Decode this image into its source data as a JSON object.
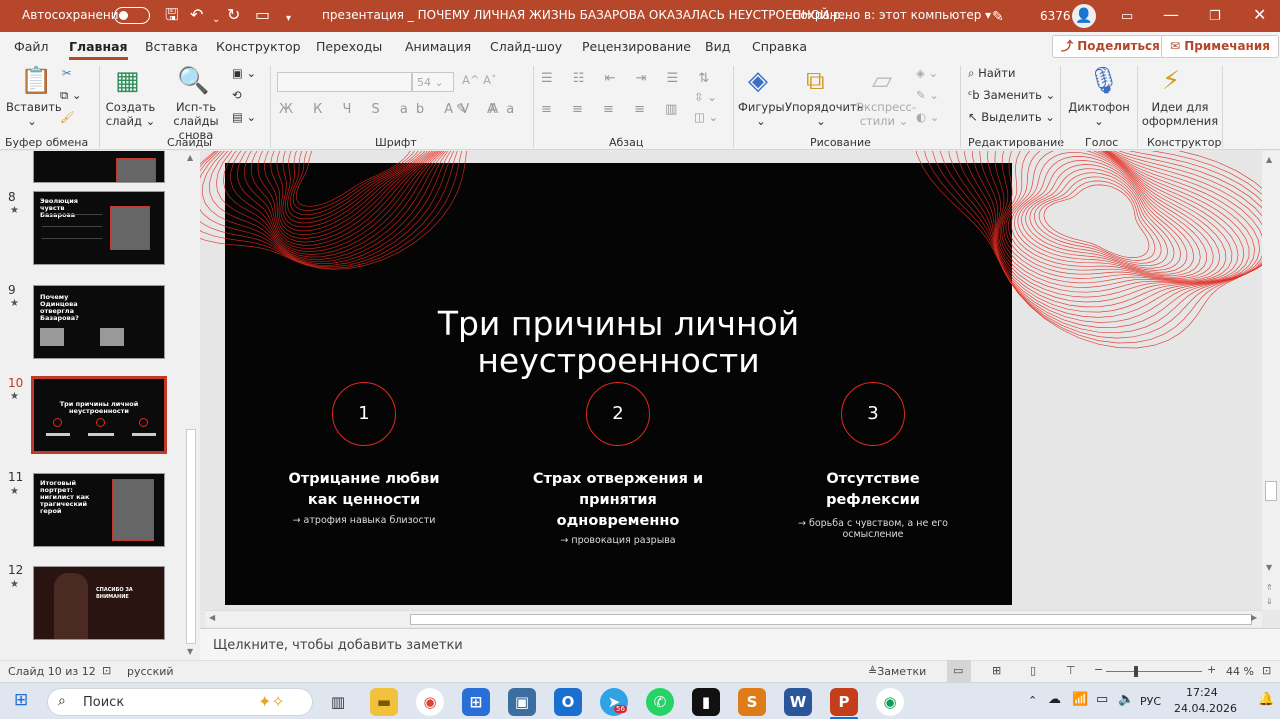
{
  "titlebar": {
    "autosave_label": "Автосохранение",
    "document_title": "презентация _ ПОЧЕМУ ЛИЧНАЯ ЖИЗНЬ БАЗАРОВА ОКАЗАЛАСЬ НЕУСТРОЕННОЙ.p...",
    "saved_status": "Сохранено в: этот компьютер",
    "user_number": "6376",
    "icons": [
      "save-icon",
      "undo-icon",
      "redo-icon",
      "present-icon",
      "customize-icon",
      "pen-icon",
      "minimize-icon",
      "maximize-icon",
      "close-icon"
    ]
  },
  "menu": {
    "tabs": [
      "Файл",
      "Главная",
      "Вставка",
      "Конструктор",
      "Переходы",
      "Анимация",
      "Слайд-шоу",
      "Рецензирование",
      "Вид",
      "Справка"
    ],
    "active": "Главная",
    "share_label": "Поделиться",
    "comments_label": "Примечания"
  },
  "ribbon": {
    "paste_label": "Вставить",
    "new_slide_label": "Создать слайд",
    "reuse_label": "Исп-ть слайды снова",
    "font_size": "54",
    "shapes_label": "Фигуры",
    "arrange_label": "Упорядочить",
    "styles_label": "Экспресс-стили",
    "find_label": "Найти",
    "replace_label": "Заменить",
    "select_label": "Выделить",
    "dictate_label": "Диктофон",
    "designer_label": "Идеи для оформления",
    "groups": [
      "Буфер обмена",
      "Слайды",
      "Шрифт",
      "Абзац",
      "Рисование",
      "Редактирование",
      "Голос",
      "Конструктор"
    ]
  },
  "thumbnails": [
    {
      "num": "8",
      "title": "Эволюция чувств Базарова"
    },
    {
      "num": "9",
      "title": "Почему Одинцова отвергла Базарова?"
    },
    {
      "num": "10",
      "title": "Три причины личной неустроенности",
      "selected": true
    },
    {
      "num": "11",
      "title": "Итоговый портрет: нигилист как трагический герой"
    },
    {
      "num": "12",
      "title": "спасибо за внимание"
    }
  ],
  "slide": {
    "title_line1": "Три причины личной",
    "title_line2": "неустроенности",
    "accent_color": "#e0291d",
    "reasons": [
      {
        "num": "1",
        "head1": "Отрицание любви",
        "head2": "как ценности",
        "head3": "",
        "sub1": "→ атрофия навыка близости",
        "sub2": ""
      },
      {
        "num": "2",
        "head1": "Страх отвержения и",
        "head2": "принятия",
        "head3": "одновременно",
        "sub1": "→ провокация разрыва",
        "sub2": ""
      },
      {
        "num": "3",
        "head1": "Отсутствие",
        "head2": "рефлексии",
        "head3": "",
        "sub1": "→ борьба с чувством, а не его",
        "sub2": "осмысление"
      }
    ]
  },
  "notes_placeholder": "Щелкните, чтобы добавить заметки",
  "status": {
    "slide_info": "Слайд 10 из 12",
    "language": "русский",
    "notes_button": "Заметки",
    "zoom": "44 %",
    "zoom_fraction": 0.3
  },
  "taskbar": {
    "search_placeholder": "Поиск",
    "lang": "РУС",
    "time": "17:24",
    "date": "24.04.2026",
    "badge": "56"
  }
}
